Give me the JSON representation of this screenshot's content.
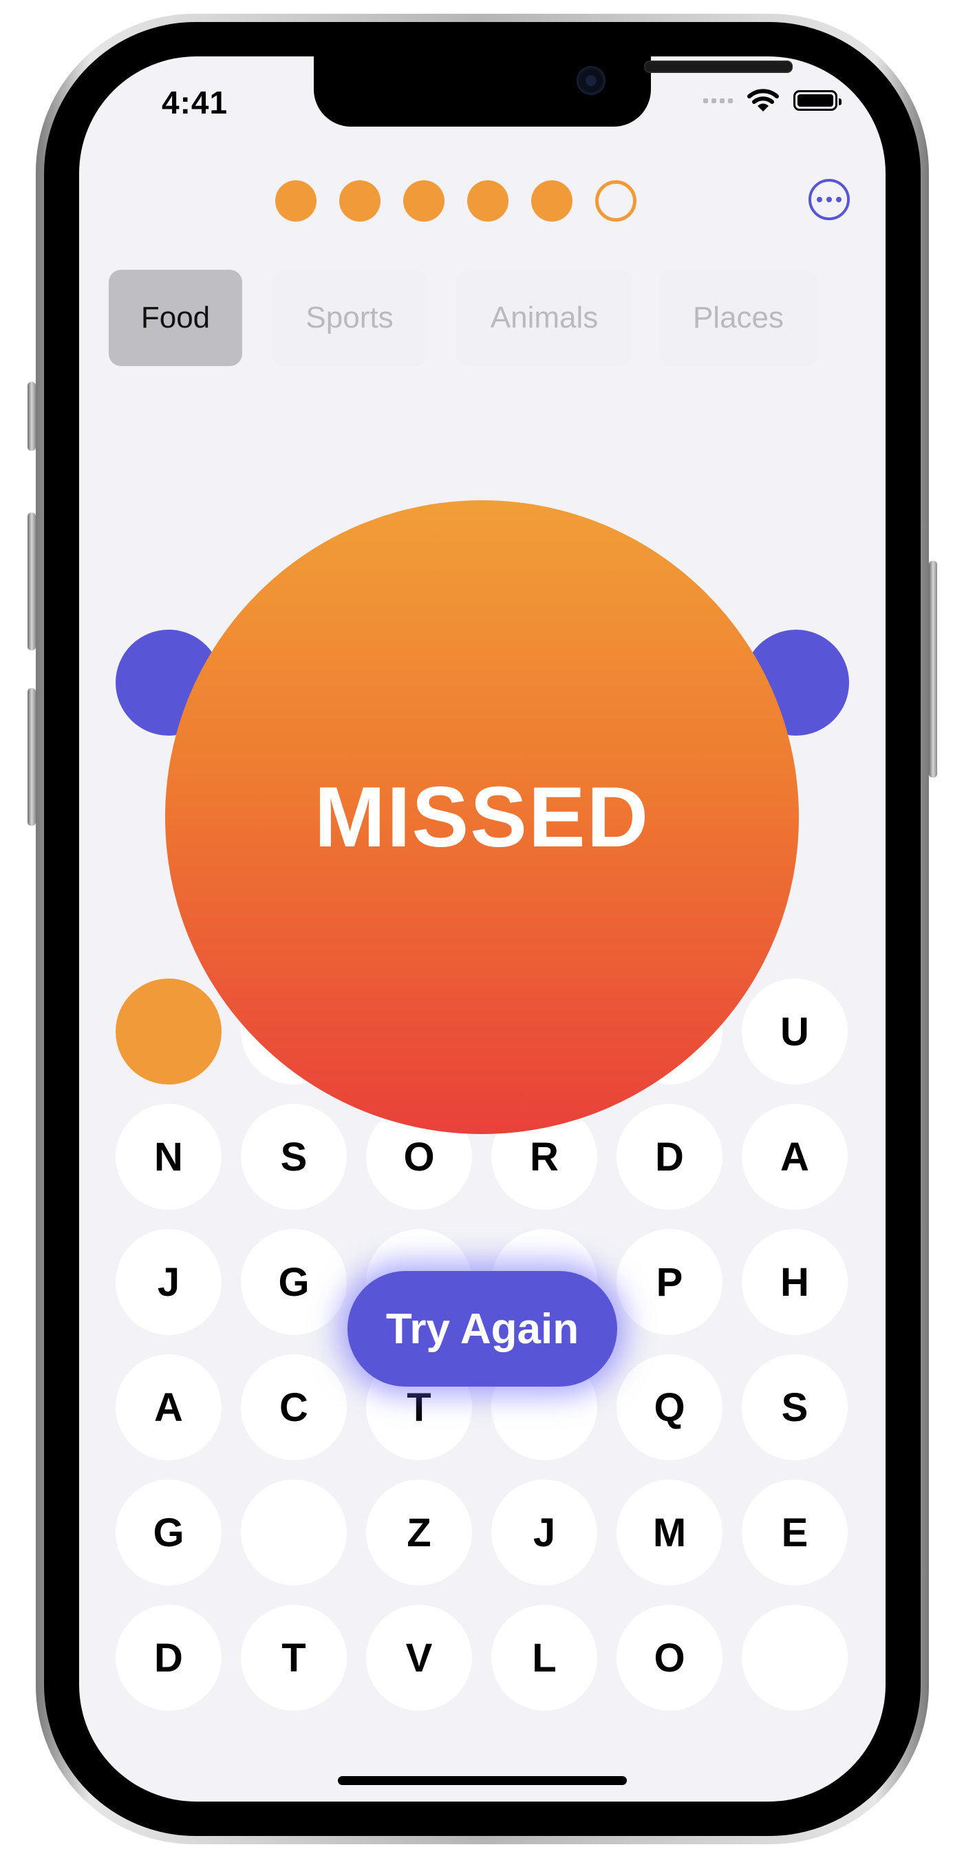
{
  "status_bar": {
    "time": "4:41"
  },
  "progress": {
    "dots": [
      "filled",
      "filled",
      "filled",
      "filled",
      "filled",
      "empty"
    ],
    "accent": "#f09a3a"
  },
  "more_icon": "ellipsis-circle-icon",
  "categories": [
    {
      "label": "Food",
      "active": true
    },
    {
      "label": "Sports",
      "active": false
    },
    {
      "label": "Animals",
      "active": false
    },
    {
      "label": "Places",
      "active": false
    }
  ],
  "result": {
    "text": "MISSED"
  },
  "try_again": {
    "label": "Try Again",
    "color": "#5856d6"
  },
  "grid": {
    "row0": [
      "",
      "",
      "",
      "",
      "",
      "U"
    ],
    "row1": [
      "N",
      "S",
      "O",
      "R",
      "D",
      "A"
    ],
    "row2": [
      "J",
      "G",
      "",
      "",
      "P",
      "H"
    ],
    "row3": [
      "A",
      "C",
      "T",
      "",
      "Q",
      "S"
    ],
    "row4": [
      "G",
      "",
      "Z",
      "J",
      "M",
      "E"
    ],
    "row5": [
      "D",
      "T",
      "V",
      "L",
      "O",
      ""
    ]
  },
  "colors": {
    "orange": "#f09a3a",
    "purple": "#5856d6",
    "background": "#f2f2f7"
  }
}
